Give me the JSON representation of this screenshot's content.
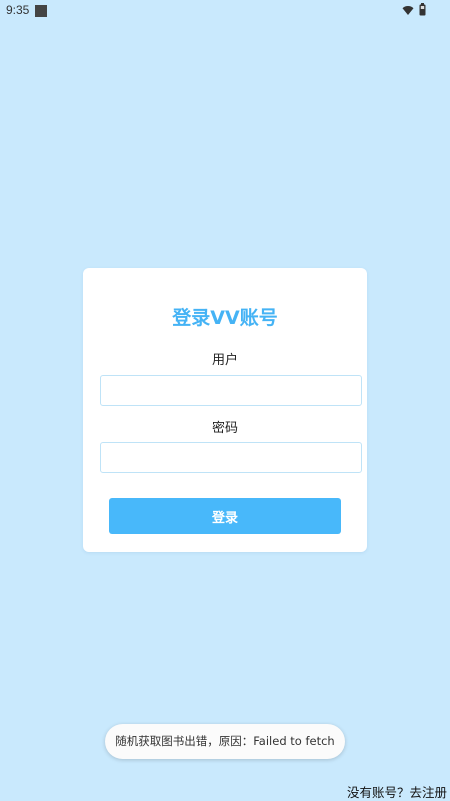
{
  "status_bar": {
    "time": "9:35",
    "icons": [
      "notification-square-icon",
      "wifi-icon",
      "battery-icon"
    ]
  },
  "login_card": {
    "title": "登录VV账号",
    "username_label": "用户",
    "username_value": "",
    "password_label": "密码",
    "password_value": "",
    "submit_label": "登录"
  },
  "toast": {
    "message": "随机获取图书出错，原因：Failed to fetch"
  },
  "footer": {
    "register_link": "没有账号？去注册"
  },
  "colors": {
    "background": "#c9e9fd",
    "accent": "#45b3f5",
    "button": "#48b8fa",
    "card": "#ffffff"
  }
}
